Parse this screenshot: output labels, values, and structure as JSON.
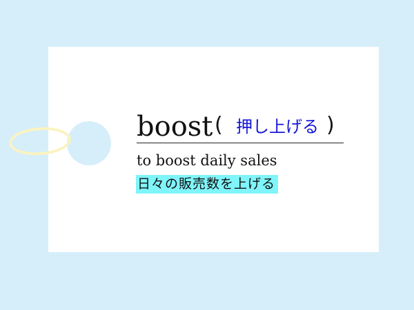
{
  "card": {
    "word": "boost",
    "paren_open": "(",
    "meaning": "押し上げる",
    "paren_close": ")",
    "example": "to boost daily sales",
    "translation": "日々の販売数を上げる"
  },
  "colors": {
    "background": "#d5eefa",
    "card": "#ffffff",
    "meaning_text": "#1414d6",
    "highlight": "#7ff4f9",
    "string": "#fbf3c0"
  }
}
